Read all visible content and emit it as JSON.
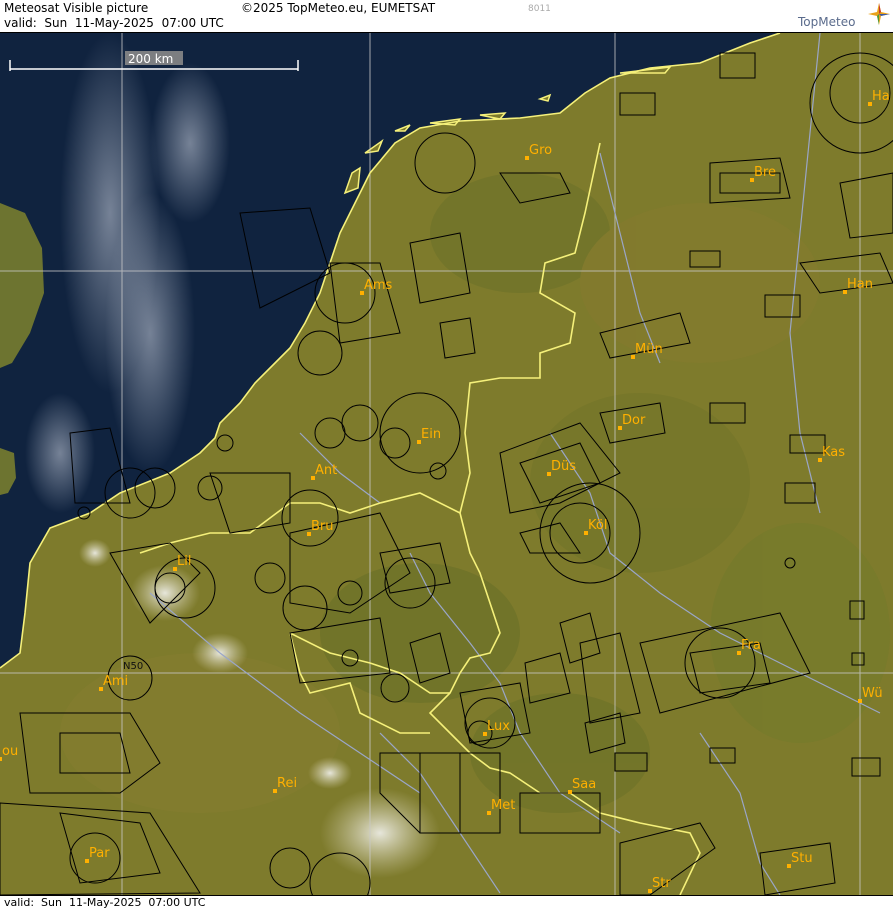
{
  "header": {
    "title": "Meteosat Visible picture",
    "copyright": "©2025 TopMeteo.eu, EUMETSAT",
    "frame_code": "8011",
    "valid": "valid:  Sun  11-May-2025  07:00 UTC",
    "logo": "TopMeteo"
  },
  "footer": {
    "valid": "valid:  Sun  11-May-2025  07:00 UTC"
  },
  "map": {
    "scale_label": "200 km",
    "grid_label": "N50",
    "colors": {
      "sea": "#10233f",
      "land": "#7f7d2a",
      "border": "#f5f07a",
      "airspace": "#000000",
      "rivers": "#9aa6c8",
      "grid": "#c8c8c8",
      "city_label": "#ffb000"
    },
    "cities": [
      {
        "name": "Gro",
        "label": "Gro"
      },
      {
        "name": "Bre",
        "label": "Bre"
      },
      {
        "name": "Ha",
        "label": "Ha"
      },
      {
        "name": "Ams",
        "label": "Ams"
      },
      {
        "name": "Han",
        "label": "Han"
      },
      {
        "name": "Mün",
        "label": "Mün"
      },
      {
        "name": "Ein",
        "label": "Ein"
      },
      {
        "name": "Dor",
        "label": "Dor"
      },
      {
        "name": "Kas",
        "label": "Kas"
      },
      {
        "name": "Ant",
        "label": "Ant"
      },
      {
        "name": "Düs",
        "label": "Düs"
      },
      {
        "name": "Bru",
        "label": "Bru"
      },
      {
        "name": "Köl",
        "label": "Köl"
      },
      {
        "name": "Lil",
        "label": "Lil"
      },
      {
        "name": "Fra",
        "label": "Fra"
      },
      {
        "name": "Ami",
        "label": "Ami"
      },
      {
        "name": "Wü",
        "label": "Wü"
      },
      {
        "name": "Lux",
        "label": "Lux"
      },
      {
        "name": "ou",
        "label": "ou"
      },
      {
        "name": "Rei",
        "label": "Rei"
      },
      {
        "name": "Saa",
        "label": "Saa"
      },
      {
        "name": "Met",
        "label": "Met"
      },
      {
        "name": "Par",
        "label": "Par"
      },
      {
        "name": "Stu",
        "label": "Stu"
      },
      {
        "name": "Str",
        "label": "Str"
      }
    ]
  }
}
